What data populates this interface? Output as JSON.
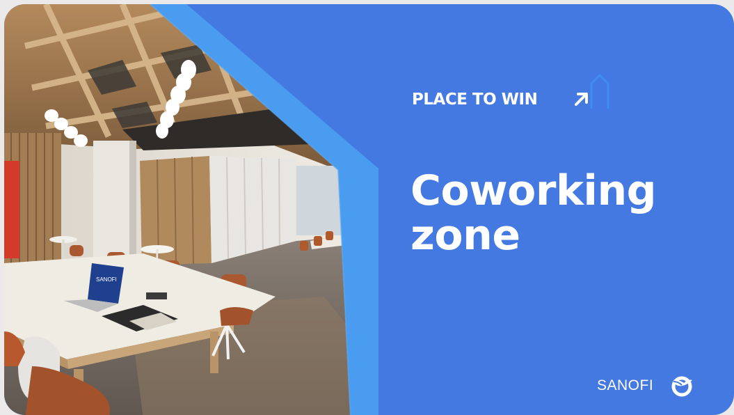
{
  "badge": {
    "label": "PLACE TO WIN",
    "icon": "arrow-up-right-icon"
  },
  "headline": {
    "line1": "Coworking",
    "line2": "zone"
  },
  "brand": {
    "name": "SANOFI",
    "logo_icon": "sanofi-bird-icon"
  },
  "photo": {
    "laptop_brand": "SANOFI"
  },
  "colors": {
    "background": "#4479e1",
    "frame_light": "#4a9cf0",
    "page": "#ece9ea",
    "text": "#ffffff"
  }
}
